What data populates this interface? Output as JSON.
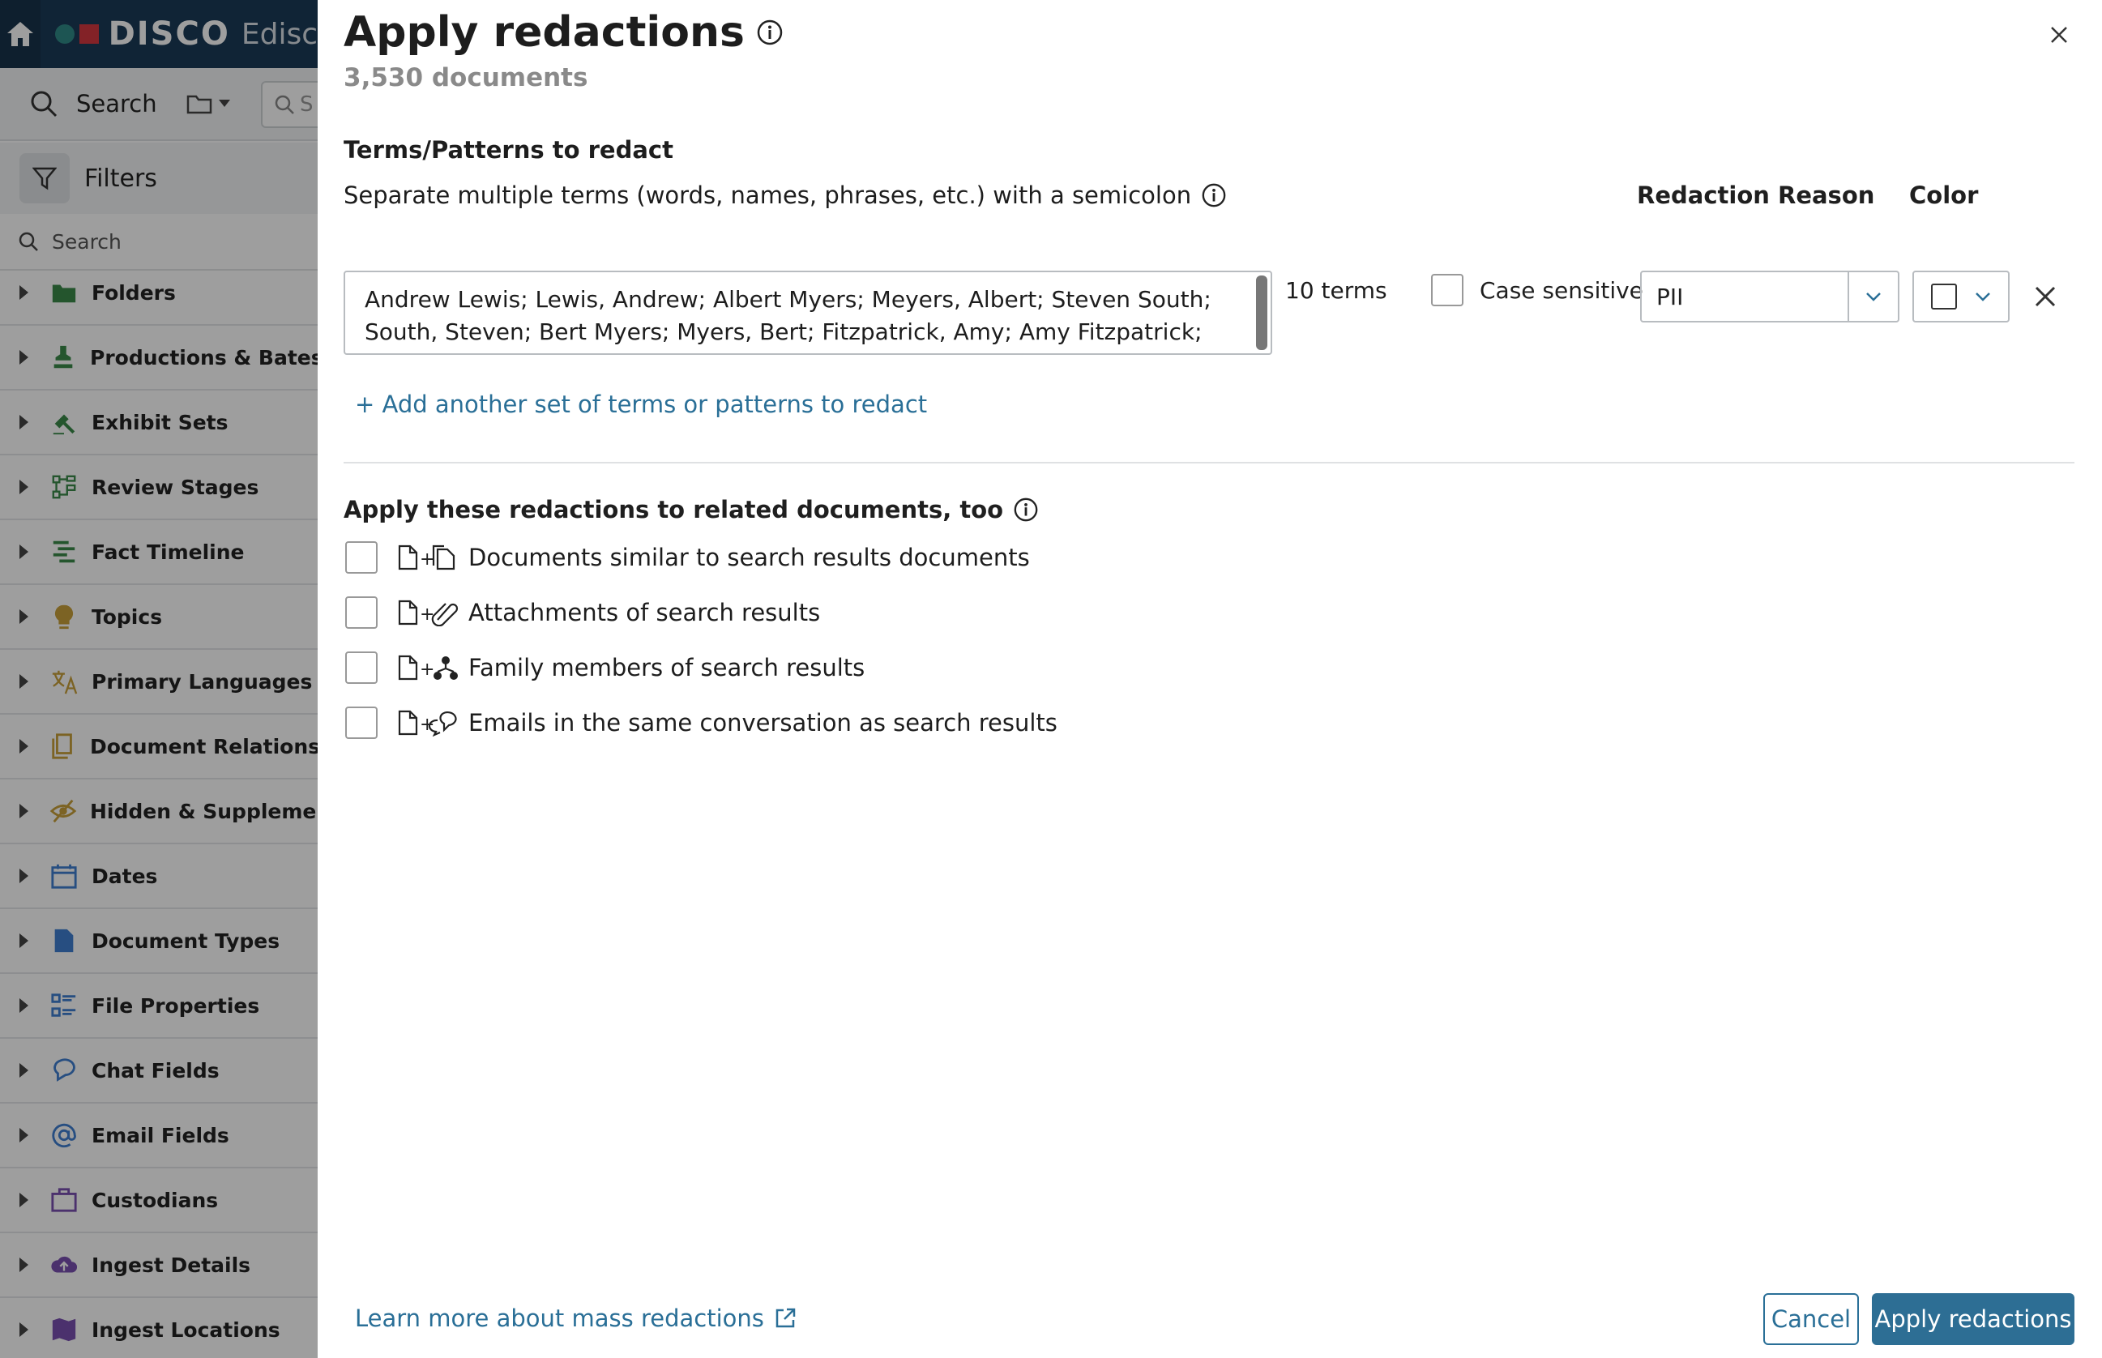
{
  "app": {
    "brand": "DISCO",
    "brand_sub": "Edisc",
    "search_label": "Search",
    "search_placeholder": "S",
    "filters_label": "Filters",
    "filter_search_placeholder": "Search",
    "facets": [
      {
        "label": "Folders",
        "icon": "folder-icon",
        "color": "#3a8a4a"
      },
      {
        "label": "Productions & Bates",
        "icon": "stamp-icon",
        "color": "#3a8a4a"
      },
      {
        "label": "Exhibit Sets",
        "icon": "gavel-icon",
        "color": "#3a8a4a"
      },
      {
        "label": "Review Stages",
        "icon": "workflow-icon",
        "color": "#3a8a4a"
      },
      {
        "label": "Fact Timeline",
        "icon": "timeline-icon",
        "color": "#3a8a4a"
      },
      {
        "label": "Topics",
        "icon": "lightbulb-icon",
        "color": "#c8a13a"
      },
      {
        "label": "Primary Languages",
        "icon": "translate-icon",
        "color": "#c8a13a"
      },
      {
        "label": "Document Relationships",
        "icon": "documents-icon",
        "color": "#c8a13a"
      },
      {
        "label": "Hidden & Supplemental",
        "icon": "eye-slash-icon",
        "color": "#c8a13a"
      },
      {
        "label": "Dates",
        "icon": "calendar-icon",
        "color": "#3f7fd0"
      },
      {
        "label": "Document Types",
        "icon": "document-icon",
        "color": "#3f7fd0"
      },
      {
        "label": "File Properties",
        "icon": "list-icon",
        "color": "#3f7fd0"
      },
      {
        "label": "Chat Fields",
        "icon": "chat-icon",
        "color": "#3f7fd0"
      },
      {
        "label": "Email Fields",
        "icon": "at-icon",
        "color": "#3f7fd0"
      },
      {
        "label": "Custodians",
        "icon": "briefcase-icon",
        "color": "#7a4fb0"
      },
      {
        "label": "Ingest Details",
        "icon": "cloud-upload-icon",
        "color": "#7a4fb0"
      },
      {
        "label": "Ingest Locations",
        "icon": "map-icon",
        "color": "#7a4fb0"
      }
    ]
  },
  "modal": {
    "title": "Apply redactions",
    "doc_count": "3,530 documents",
    "terms_heading": "Terms/Patterns to redact",
    "terms_help": "Separate multiple terms (words, names, phrases, etc.) with a semicolon",
    "col_reason": "Redaction Reason",
    "col_color": "Color",
    "terms_value": "Andrew Lewis; Lewis, Andrew; Albert Myers; Meyers, Albert; Steven South; South, Steven; Bert Myers; Myers, Bert;  Fitzpatrick, Amy; Amy Fitzpatrick;",
    "terms_count": "10 terms",
    "case_sensitive_label": "Case sensitive",
    "reason_value": "PII",
    "add_link": "+ Add another set of terms or patterns to redact",
    "related_heading": "Apply these redactions to related documents, too",
    "related": [
      {
        "label": "Documents similar to search results documents",
        "icon": "similar-documents-icon"
      },
      {
        "label": "Attachments of search results",
        "icon": "paperclip-icon"
      },
      {
        "label": "Family members of search results",
        "icon": "family-tree-icon"
      },
      {
        "label": "Emails in the same conversation as search results",
        "icon": "conversation-icon"
      }
    ],
    "learn_link": "Learn more about mass redactions",
    "cancel_label": "Cancel",
    "apply_label": "Apply redactions"
  },
  "colors": {
    "accent": "#2d6e94",
    "link": "#2a6f97",
    "topbar": "#1b3a57"
  }
}
